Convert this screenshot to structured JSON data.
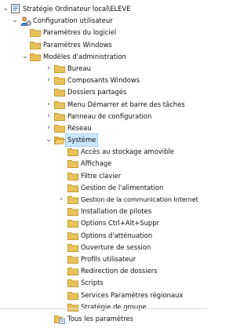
{
  "tree": {
    "root": {
      "label": "Stratégie Ordinateur local\\ELEVE",
      "expanded": true
    },
    "items": [
      {
        "label": "Configuration utilisateur",
        "expanded": true,
        "icon": "user-config-icon"
      },
      {
        "label": "Paramètres du logiciel",
        "icon": "folder-icon"
      },
      {
        "label": "Paramètres Windows",
        "icon": "folder-icon"
      },
      {
        "label": "Modèles d'administration",
        "expanded": true,
        "icon": "folder-icon"
      },
      {
        "label": "Bureau",
        "expandable": true,
        "icon": "folder-icon"
      },
      {
        "label": "Composants Windows",
        "expandable": true,
        "icon": "folder-icon"
      },
      {
        "label": "Dossiers partagés",
        "icon": "folder-icon"
      },
      {
        "label": "Menu Démarrer et barre des tâches",
        "expandable": true,
        "icon": "folder-icon"
      },
      {
        "label": "Panneau de configuration",
        "expandable": true,
        "icon": "folder-icon"
      },
      {
        "label": "Réseau",
        "expandable": true,
        "icon": "folder-icon"
      },
      {
        "label": "Système",
        "expanded": true,
        "selected": true,
        "icon": "folder-open-icon"
      },
      {
        "label": "Accès au stockage amovible",
        "icon": "folder-icon"
      },
      {
        "label": "Affichage",
        "icon": "folder-icon"
      },
      {
        "label": "Filtre clavier",
        "icon": "folder-icon"
      },
      {
        "label": "Gestion de l'alimentation",
        "icon": "folder-icon"
      },
      {
        "label": "Gestion de la communication Internet",
        "expandable": true,
        "icon": "folder-icon"
      },
      {
        "label": "Installation de pilotes",
        "icon": "folder-icon"
      },
      {
        "label": "Options Ctrl+Alt+Suppr",
        "icon": "folder-icon"
      },
      {
        "label": "Options d'atténuation",
        "icon": "folder-icon"
      },
      {
        "label": "Ouverture de session",
        "icon": "folder-icon"
      },
      {
        "label": "Profils utilisateur",
        "icon": "folder-icon"
      },
      {
        "label": "Redirection de dossiers",
        "icon": "folder-icon"
      },
      {
        "label": "Scripts",
        "icon": "folder-icon"
      },
      {
        "label": "Services Paramètres régionaux",
        "icon": "folder-icon"
      },
      {
        "label": "Stratégie de groupe",
        "icon": "folder-icon"
      },
      {
        "label": "Tous les paramètres",
        "icon": "all-settings-icon"
      }
    ]
  },
  "colors": {
    "folder": "#e8c15a",
    "folder_dark": "#c99a2e",
    "selection_bg": "#cce8ff",
    "selection_border": "#99d1ff"
  }
}
